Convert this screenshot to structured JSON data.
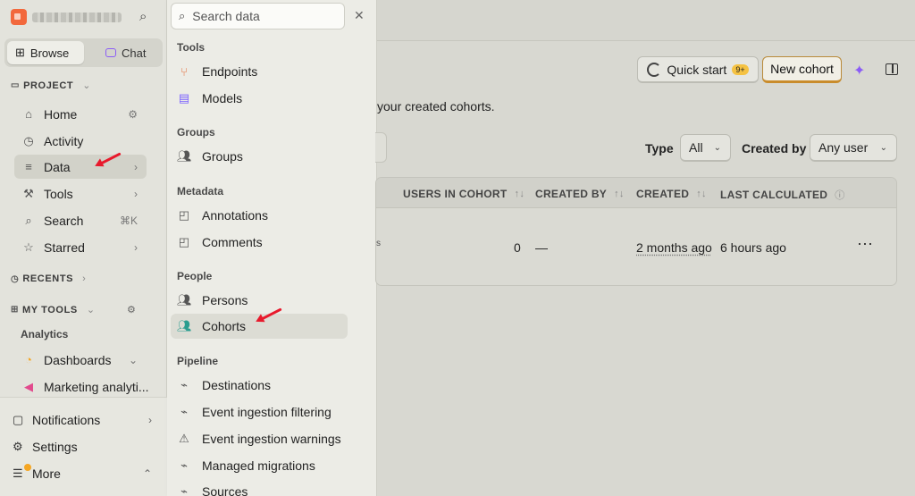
{
  "sidebar": {
    "segment": {
      "browse_label": "Browse",
      "chat_label": "Chat"
    },
    "project_heading": "PROJECT",
    "nav": [
      {
        "label": "Home"
      },
      {
        "label": "Activity"
      },
      {
        "label": "Data"
      },
      {
        "label": "Tools"
      },
      {
        "label": "Search",
        "shortcut": "⌘K"
      },
      {
        "label": "Starred"
      }
    ],
    "recents_heading": "RECENTS",
    "my_tools_heading": "MY TOOLS",
    "analytics_label": "Analytics",
    "tools": [
      {
        "label": "Dashboards"
      },
      {
        "label": "Marketing analyti..."
      }
    ],
    "bottom": [
      {
        "label": "Notifications"
      },
      {
        "label": "Settings"
      },
      {
        "label": "More"
      }
    ]
  },
  "panel": {
    "search_placeholder": "Search data",
    "groups": [
      {
        "title": "Tools",
        "items": [
          "Endpoints",
          "Models"
        ]
      },
      {
        "title": "Groups",
        "items": [
          "Groups"
        ]
      },
      {
        "title": "Metadata",
        "items": [
          "Annotations",
          "Comments"
        ]
      },
      {
        "title": "People",
        "items": [
          "Persons",
          "Cohorts"
        ]
      },
      {
        "title": "Pipeline",
        "items": [
          "Destinations",
          "Event ingestion filtering",
          "Event ingestion warnings",
          "Managed migrations",
          "Sources"
        ]
      }
    ]
  },
  "main": {
    "quick_start_label": "Quick start",
    "quick_start_badge": "9+",
    "new_cohort_label": "New cohort",
    "description": "your created cohorts.",
    "filters": {
      "type_label": "Type",
      "type_value": "All",
      "created_by_label": "Created by",
      "created_by_value": "Any user"
    },
    "table": {
      "columns": [
        "USERS IN COHORT",
        "CREATED BY",
        "CREATED",
        "LAST CALCULATED"
      ],
      "rows": [
        {
          "users": "0",
          "created_by": "—",
          "created": "2 months ago",
          "last_calculated": "6 hours ago"
        }
      ]
    }
  },
  "colors": {
    "accent_orange": "#c98c2c",
    "annotation_red": "#e8192c",
    "ai_purple": "#8b5cf6"
  }
}
